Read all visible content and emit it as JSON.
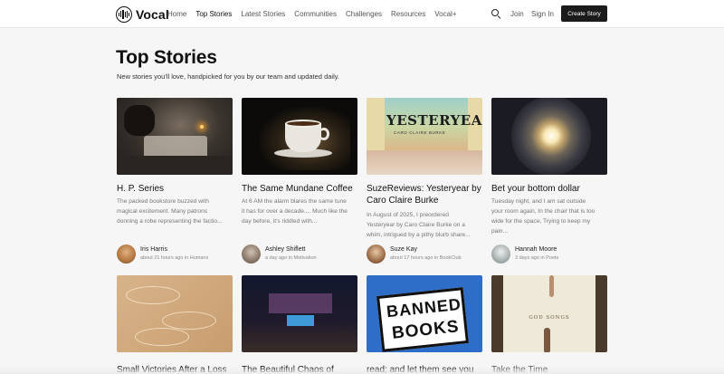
{
  "header": {
    "logo_text": "Vocal",
    "nav": [
      "Home",
      "Top Stories",
      "Latest Stories",
      "Communities",
      "Challenges",
      "Resources",
      "Vocal+"
    ],
    "active_nav": "Top Stories",
    "join_label": "Join",
    "signin_label": "Sign In",
    "create_label": "Create Story"
  },
  "page": {
    "title": "Top Stories",
    "subtitle": "New stories you'll love, handpicked for you by our team and updated daily."
  },
  "cards": [
    {
      "title": "H. P. Series",
      "excerpt": "The packed bookstore buzzed with magical excitement. Many patrons donning a robe representing the factio...",
      "author": "Iris Harris",
      "meta": "about 21 hours ago in Humans"
    },
    {
      "title": "The Same Mundane Coffee",
      "excerpt": "At 6 AM the alarm blares the same tune it has for over a decade.... Much like the day before, it's riddled with...",
      "author": "Ashley Shiflett",
      "meta": "a day ago in Motivation"
    },
    {
      "title": "SuzeReviews: Yesteryear by Caro Claire Burke",
      "excerpt": "In August of 2025, I preordered Yesteryear by Caro Claire Burke on a whim, intrigued by a pithy blurb share...",
      "author": "Suze Kay",
      "meta": "about 17 hours ago in BookClub",
      "image_text": [
        "YESTERYEAR",
        "CARO CLAIRE BURKE"
      ]
    },
    {
      "title": "Bet your bottom dollar",
      "excerpt": "Tuesday night, and I am sat outside your room again, In the chair that is too wide for the space, Trying to keep my pain...",
      "author": "Hannah Moore",
      "meta": "3 days ago in Poets"
    },
    {
      "title": "Small Victories After a Loss"
    },
    {
      "title": "The Beautiful Chaos of"
    },
    {
      "title": "read; and let them see you",
      "image_text": [
        "BANNED",
        "BOOKS"
      ]
    },
    {
      "title": "Take the Time",
      "image_text": [
        "GOD SONGS"
      ]
    }
  ],
  "icons": {
    "search": "search-icon",
    "logo": "vocal-logo-icon"
  },
  "colors": {
    "background": "#f6f6f6",
    "header": "#ffffff",
    "button": "#1b1b1b",
    "text": "#111111",
    "muted": "#777777"
  }
}
